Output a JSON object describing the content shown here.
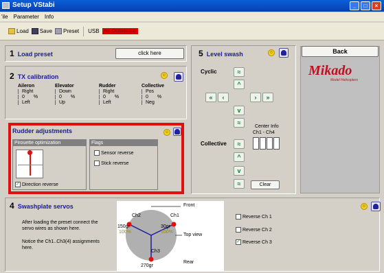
{
  "window": {
    "title": "Setup VStabi",
    "controls": [
      "_",
      "□",
      "×"
    ]
  },
  "menu": {
    "items": [
      "File",
      "Parameter",
      "Info"
    ],
    "display": [
      "'ile",
      "Parameter",
      "Info"
    ]
  },
  "toolbar": {
    "load": "Load",
    "save": "Save",
    "preset": "Preset",
    "usb": "USB",
    "status": "No Connection"
  },
  "load_preset": {
    "num": "1",
    "title": "Load preset",
    "button": "click here"
  },
  "tx": {
    "num": "2",
    "title": "TX calibration",
    "columns": [
      {
        "name": "Aileron",
        "top": "Right",
        "mid": "0",
        "unit": "%",
        "bottom": "Left"
      },
      {
        "name": "Elevator",
        "top": "Down",
        "mid": "0",
        "unit": "%",
        "bottom": "Up"
      },
      {
        "name": "Rudder",
        "top": "Right",
        "mid": "0",
        "unit": "%",
        "bottom": "Left"
      },
      {
        "name": "Collective",
        "top": "Pos",
        "mid": "0",
        "unit": "%",
        "bottom": "Neg"
      }
    ]
  },
  "rudder": {
    "title": "Rudder adjustments",
    "pirouette_label": "Pirouette optimization",
    "flags_label": "Flags",
    "sensor_reverse": "Sensor reverse",
    "stick_reverse": "Stick reverse",
    "direction_reverse": "Direction reverse",
    "direction_reverse_checked": true
  },
  "level_swash": {
    "num": "5",
    "title": "Level swash",
    "cyclic": "Cyclic",
    "collective": "Collective",
    "center_info": "Center Info",
    "channels": "Ch1 - Ch4",
    "clear": "Clear"
  },
  "back": {
    "label": "Back"
  },
  "logo": {
    "brand": "Mikado",
    "tagline": "Model Helicopters"
  },
  "swashplate": {
    "num": "4",
    "title": "Swashplate servos",
    "instructions": "After loading the preset connect the servo wires as shown here.",
    "notice": "Notice the Ch1..Ch3(4) assignments here.",
    "diagram": {
      "front": "Front",
      "rear": "Rear",
      "top_view": "Top view",
      "ch1": "Ch1",
      "ch2": "Ch2",
      "ch3": "Ch3",
      "left_angle": "150gr",
      "right_angle": "30gr",
      "bottom_angle": "270gr",
      "left_pct": "100%",
      "right_pct": "100%"
    },
    "reverse": [
      {
        "label": "Reverse Ch 1",
        "checked": false
      },
      {
        "label": "Reverse Ch 2",
        "checked": false
      },
      {
        "label": "Reverse Ch 3",
        "checked": true
      }
    ]
  },
  "colors": {
    "title_blue": "#1a1aa0",
    "highlight_red": "#e01010",
    "arrow_green": "#008030",
    "logo_red": "#c01020"
  }
}
